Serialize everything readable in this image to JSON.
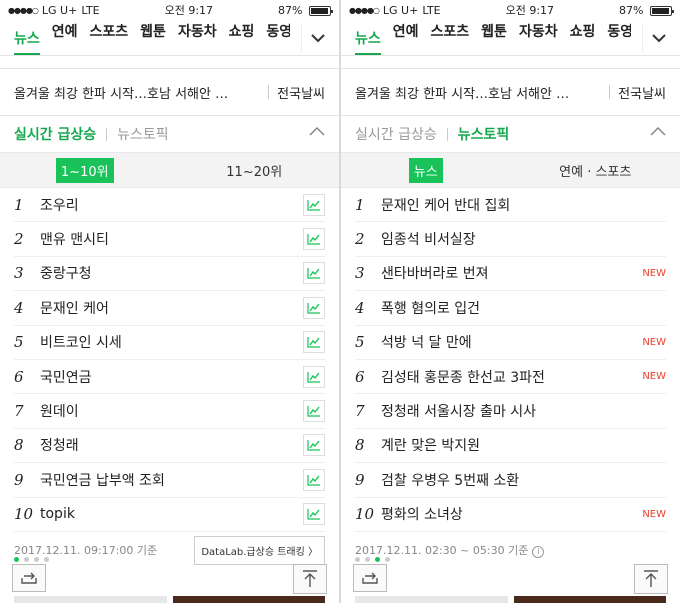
{
  "status": {
    "carrier": "LG U+",
    "network": "LTE",
    "time": "오전 9:17",
    "battery": "87%",
    "battery_level": 0.87
  },
  "nav_tabs": [
    "뉴스",
    "연예",
    "스포츠",
    "웹툰",
    "자동차",
    "쇼핑",
    "동영"
  ],
  "headline": {
    "text": "올겨울 최강 한파 시작…호남 서해안 …",
    "weather": "전국날씨"
  },
  "left": {
    "section_tabs": {
      "active": "실시간 급상승",
      "inactive": "뉴스토픽"
    },
    "sub_tabs": [
      "1~10위",
      "11~20위"
    ],
    "items": [
      {
        "rank": "1",
        "keyword": "조우리"
      },
      {
        "rank": "2",
        "keyword": "맨유 맨시티"
      },
      {
        "rank": "3",
        "keyword": "중랑구청"
      },
      {
        "rank": "4",
        "keyword": "문재인 케어"
      },
      {
        "rank": "5",
        "keyword": "비트코인 시세"
      },
      {
        "rank": "6",
        "keyword": "국민연금"
      },
      {
        "rank": "7",
        "keyword": "원데이"
      },
      {
        "rank": "8",
        "keyword": "정청래"
      },
      {
        "rank": "9",
        "keyword": "국민연금 납부액 조회"
      },
      {
        "rank": "10",
        "keyword": "topik"
      }
    ],
    "timestamp": "2017.12.11. 09:17:00 기준",
    "datalab": "DataLab.급상승 트래킹 〉"
  },
  "right": {
    "section_tabs": {
      "inactive": "실시간 급상승",
      "active": "뉴스토픽"
    },
    "sub_tabs": [
      "뉴스",
      "연예 · 스포츠"
    ],
    "items": [
      {
        "rank": "1",
        "keyword": "문재인 케어 반대 집회",
        "badge": ""
      },
      {
        "rank": "2",
        "keyword": "임종석 비서실장",
        "badge": ""
      },
      {
        "rank": "3",
        "keyword": "샌타바버라로 번져",
        "badge": "NEW"
      },
      {
        "rank": "4",
        "keyword": "폭행 혐의로 입건",
        "badge": ""
      },
      {
        "rank": "5",
        "keyword": "석방 넉 달 만에",
        "badge": "NEW"
      },
      {
        "rank": "6",
        "keyword": "김성태 홍문종 한선교 3파전",
        "badge": "NEW"
      },
      {
        "rank": "7",
        "keyword": "정청래 서울시장 출마 시사",
        "badge": ""
      },
      {
        "rank": "8",
        "keyword": "계란 맞은 박지원",
        "badge": ""
      },
      {
        "rank": "9",
        "keyword": "검찰 우병우 5번째 소환",
        "badge": ""
      },
      {
        "rank": "10",
        "keyword": "평화의 소녀상",
        "badge": "NEW"
      }
    ],
    "timestamp": "2017.12.11. 02:30 ~ 05:30 기준"
  },
  "colors": {
    "accent": "#17a84f",
    "new_badge": "#e8412c"
  }
}
